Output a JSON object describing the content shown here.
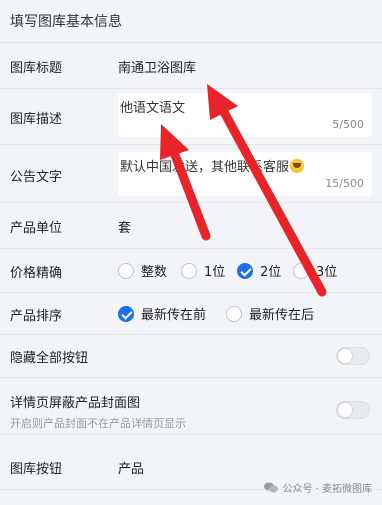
{
  "header": {
    "title": "填写图库基本信息"
  },
  "fields": {
    "gallery_title": {
      "label": "图库标题",
      "value": "南通卫浴图库"
    },
    "gallery_desc": {
      "label": "图库描述",
      "value": "他语文语文",
      "counter": "5/500"
    },
    "notice": {
      "label": "公告文字",
      "value": "默认中国发送，其他联系客服",
      "emoji": "😁",
      "counter": "15/500"
    },
    "unit": {
      "label": "产品单位",
      "value": "套"
    },
    "precision": {
      "label": "价格精确",
      "options": [
        "整数",
        "1位",
        "2位",
        "3位"
      ],
      "selected": "2位"
    },
    "sort": {
      "label": "产品排序",
      "options": [
        "最新传在前",
        "最新传在后"
      ],
      "selected": "最新传在前"
    },
    "hide_buttons": {
      "label": "隐藏全部按钮",
      "enabled": false
    },
    "hide_cover": {
      "label": "详情页屏蔽产品封面图",
      "hint": "开启则产品封面不在产品详情页显示",
      "enabled": false
    },
    "gallery_button": {
      "label": "图库按钮",
      "value": "产品"
    }
  },
  "annotations": {
    "arrow_color": "#e8232a"
  },
  "watermark": {
    "text": "公众号 · 麦拓微图库"
  }
}
